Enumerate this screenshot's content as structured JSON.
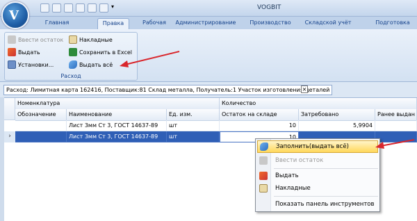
{
  "window": {
    "title": "VOGBIT"
  },
  "tabs": [
    "Главная",
    "Правка",
    "Рабочая",
    "Администрирование",
    "Производство",
    "Складской учёт",
    "Подготовка"
  ],
  "active_tab": "Правка",
  "ribbon": {
    "group_label": "Расход",
    "buttons": {
      "enter_balance": "Ввести остаток",
      "issue": "Выдать",
      "settings": "Установки...",
      "invoices": "Накладные",
      "save_excel": "Сохранить в Excel",
      "issue_all": "Выдать всё"
    }
  },
  "filter": {
    "text": "Расход: Лимитная карта 162416, Поставщик:81 Склад металла, Получатель:1 Участок изготовления деталей",
    "close": "×"
  },
  "grid": {
    "group_headers": {
      "nomenclature": "Номенклатура",
      "quantity": "Количество"
    },
    "columns": [
      "Обозначение",
      "Наименование",
      "Ед. изм.",
      "Остаток на складе",
      "Затребовано",
      "Ранее выдан"
    ],
    "rows": [
      {
        "designation": "",
        "name": "Лист 3мм Ст 3, ГОСТ 14637-89",
        "unit": "шт",
        "stock": "10",
        "requested": "5,9904",
        "prev": ""
      },
      {
        "designation": "",
        "name": "Лист 3мм Ст 3, ГОСТ 14637-89",
        "unit": "шт",
        "stock": "10",
        "requested": "",
        "prev": ""
      }
    ],
    "row_indicator": "›"
  },
  "context_menu": {
    "fill": "Заполнить(выдать всё)",
    "enter_balance": "Ввести остаток",
    "issue": "Выдать",
    "invoices": "Накладные",
    "show_toolbar": "Показать панель инструментов"
  },
  "colors": {
    "accent": "#2f5fb6",
    "highlight": "#ffd75a",
    "arrow": "#d9262c"
  }
}
